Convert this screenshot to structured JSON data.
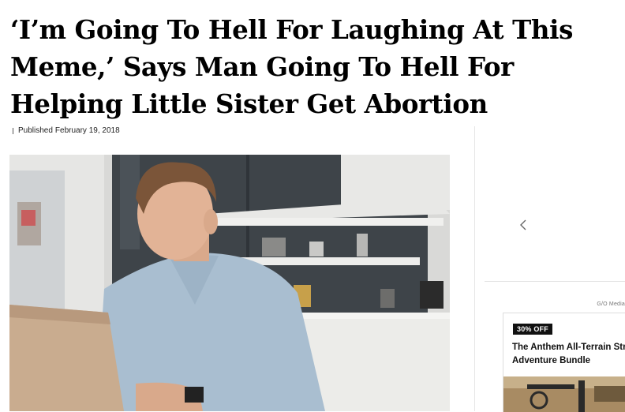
{
  "article": {
    "headline": "‘I’m Going To Hell For Laughing At This Meme,’ Says Man Going To Hell For Helping Little Sister Get Abortion",
    "published_label": "Published",
    "published_date": "February 19, 2018"
  },
  "sidebar": {
    "carousel_prev_icon": "chevron-left-icon",
    "ad_label": "G/O Media",
    "deal": {
      "badge": "30% OFF",
      "title_line1": "The Anthem All-Terrain Strolle",
      "title_line2": "Adventure Bundle"
    }
  }
}
